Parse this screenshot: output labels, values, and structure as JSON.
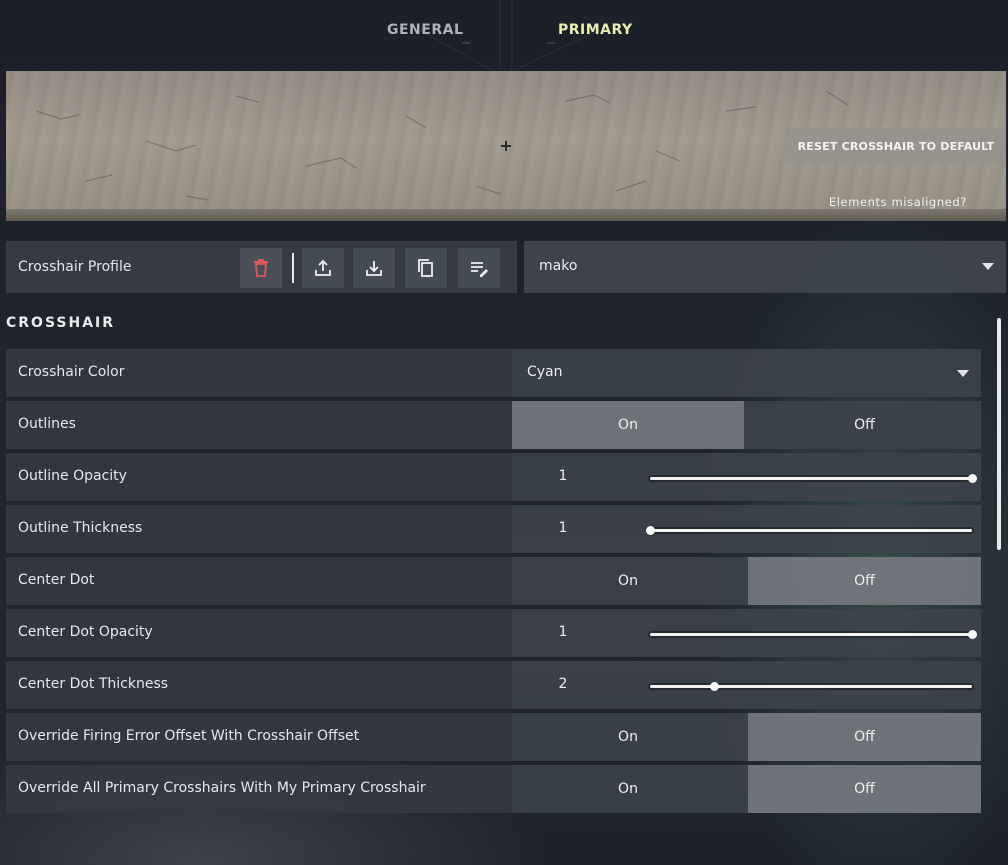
{
  "nav": {
    "tabs": [
      {
        "label": "GENERAL"
      },
      {
        "label": "PRIMARY"
      }
    ]
  },
  "preview": {
    "reset_label": "RESET CROSSHAIR TO DEFAULT",
    "misaligned_label": "Elements misaligned?"
  },
  "profile": {
    "label": "Crosshair Profile",
    "selected": "mako",
    "icons": [
      "trash-icon",
      "export-icon",
      "import-icon",
      "copy-icon",
      "edit-list-icon"
    ]
  },
  "section": {
    "title": "CROSSHAIR"
  },
  "rows": [
    {
      "label": "Crosshair Color",
      "value": "Cyan"
    },
    {
      "label": "Outlines",
      "on": "On",
      "off": "Off",
      "selected": "On"
    },
    {
      "label": "Outline Opacity",
      "value": "1",
      "slider": 1.0
    },
    {
      "label": "Outline Thickness",
      "value": "1",
      "slider": 0.0
    },
    {
      "label": "Center Dot",
      "on": "On",
      "off": "Off",
      "selected": "Off"
    },
    {
      "label": "Center Dot Opacity",
      "value": "1",
      "slider": 1.0
    },
    {
      "label": "Center Dot Thickness",
      "value": "2",
      "slider": 0.2
    },
    {
      "label": "Override Firing Error Offset With Crosshair Offset",
      "on": "On",
      "off": "Off",
      "selected": "Off"
    },
    {
      "label": "Override All Primary Crosshairs With My Primary Crosshair",
      "on": "On",
      "off": "Off",
      "selected": "Off"
    }
  ],
  "colors": {
    "accent_tab": "#e9eeb0",
    "trash_red": "#e0565b"
  }
}
